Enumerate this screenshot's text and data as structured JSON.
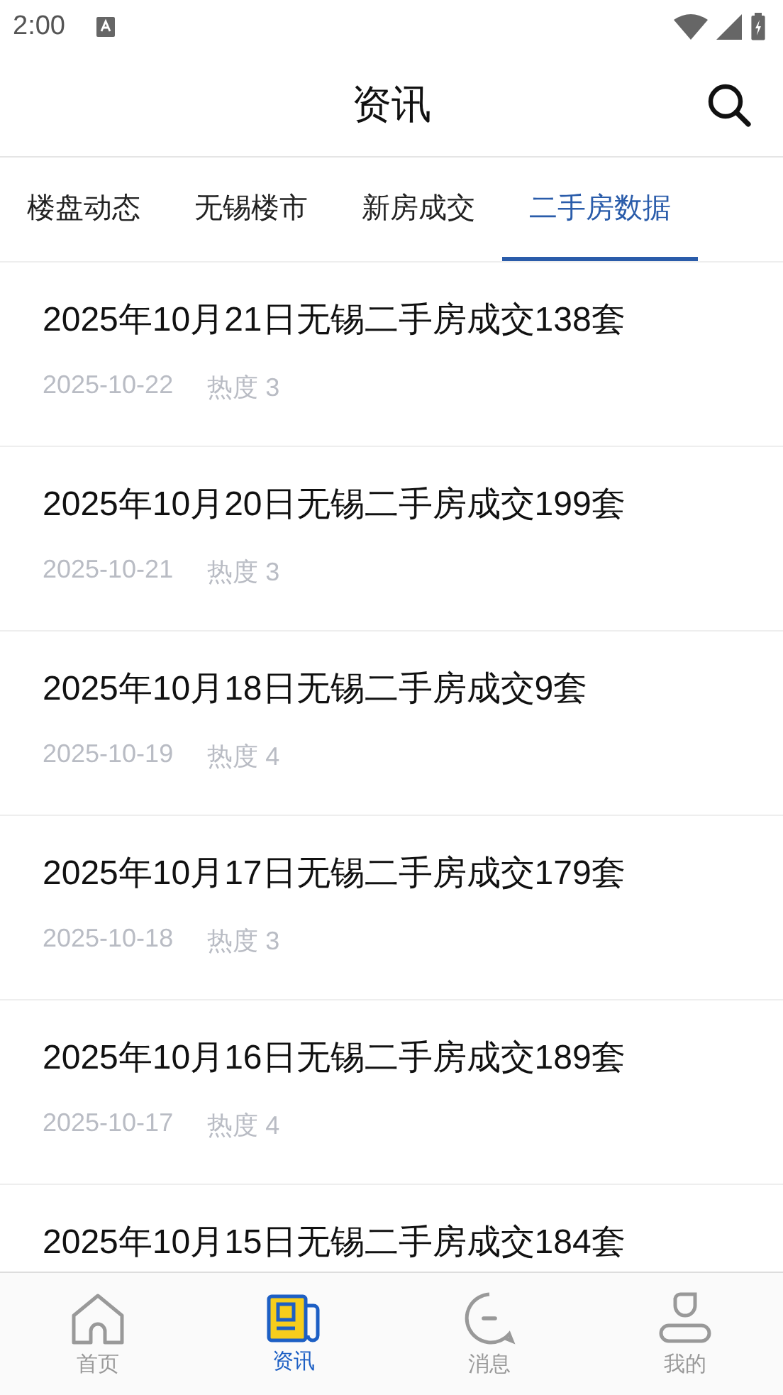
{
  "status_bar": {
    "time": "2:00"
  },
  "header": {
    "title": "资讯"
  },
  "tabs": [
    {
      "label": "楼盘动态",
      "selected": false
    },
    {
      "label": "无锡楼市",
      "selected": false
    },
    {
      "label": "新房成交",
      "selected": false
    },
    {
      "label": "二手房数据",
      "selected": true
    }
  ],
  "articles": [
    {
      "title": "2025年10月21日无锡二手房成交138套",
      "date": "2025-10-22",
      "heat": "热度 3"
    },
    {
      "title": "2025年10月20日无锡二手房成交199套",
      "date": "2025-10-21",
      "heat": "热度 3"
    },
    {
      "title": "2025年10月18日无锡二手房成交9套",
      "date": "2025-10-19",
      "heat": "热度 4"
    },
    {
      "title": "2025年10月17日无锡二手房成交179套",
      "date": "2025-10-18",
      "heat": "热度 3"
    },
    {
      "title": "2025年10月16日无锡二手房成交189套",
      "date": "2025-10-17",
      "heat": "热度 4"
    },
    {
      "title": "2025年10月15日无锡二手房成交184套"
    }
  ],
  "bottom_nav": [
    {
      "kind": "home",
      "label": "首页",
      "selected": false
    },
    {
      "kind": "news",
      "label": "资讯",
      "selected": true
    },
    {
      "kind": "message",
      "label": "消息",
      "selected": false
    },
    {
      "kind": "profile",
      "label": "我的",
      "selected": false
    }
  ]
}
